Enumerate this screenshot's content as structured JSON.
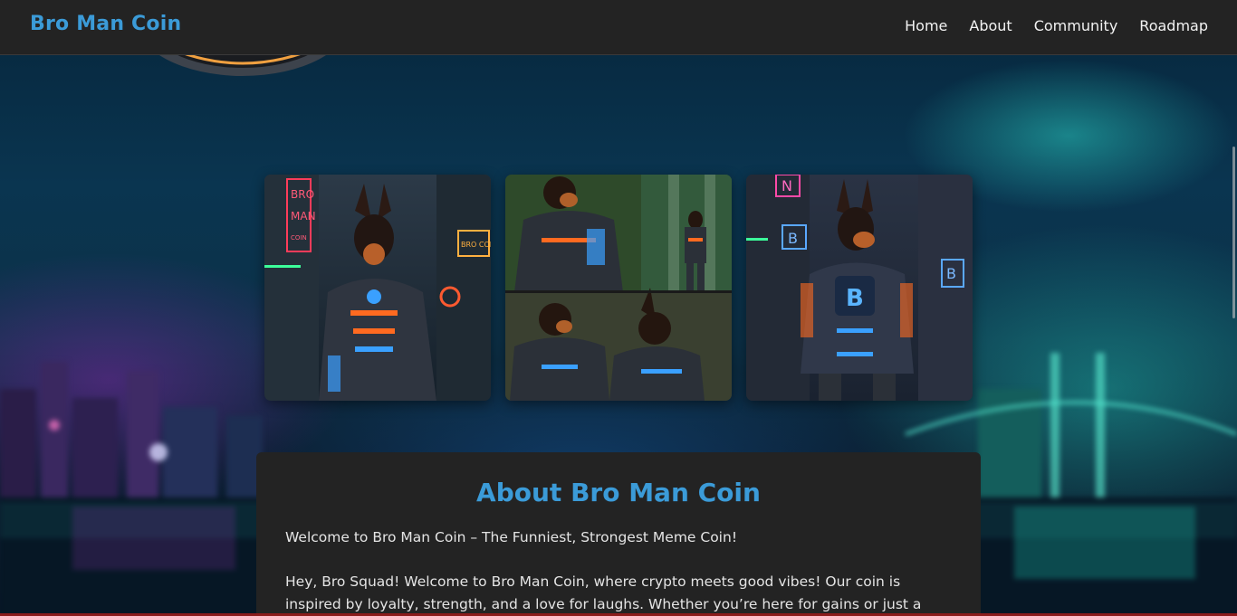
{
  "nav": {
    "brand": "Bro Man Coin",
    "links": [
      "Home",
      "About",
      "Community",
      "Roadmap"
    ]
  },
  "gallery": {
    "images": [
      {
        "icon": "cyber-doberman-image",
        "sign_lines": [
          "BRO",
          "MAN",
          "COIN"
        ],
        "side_sign": "BRO COIN"
      },
      {
        "icon": "cyber-doberman-collage-image"
      },
      {
        "icon": "cyber-doberman-b-image",
        "chest_letter": "B",
        "signs": [
          "N",
          "B",
          "B"
        ]
      }
    ]
  },
  "about": {
    "title": "About Bro Man Coin",
    "paragraph1": "Welcome to Bro Man Coin – The Funniest, Strongest Meme Coin!",
    "paragraph2": "Hey, Bro Squad! Welcome to Bro Man Coin, where crypto meets good vibes! Our coin is inspired by loyalty, strength, and a love for laughs. Whether you’re here for gains or just a good time, Bro Man"
  },
  "colors": {
    "brand": "#3b9bd8",
    "nav_bg": "#232323",
    "card_bg": "#232323",
    "text": "#e4e4e4"
  }
}
